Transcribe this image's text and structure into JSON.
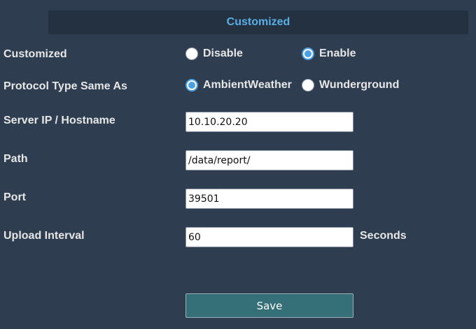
{
  "section": {
    "title": "Customized"
  },
  "fields": {
    "customized": {
      "label": "Customized",
      "options": [
        "Disable",
        "Enable"
      ],
      "selected": "Enable"
    },
    "protocol": {
      "label": "Protocol Type Same As",
      "options": [
        "AmbientWeather",
        "Wunderground"
      ],
      "selected": "AmbientWeather"
    },
    "server": {
      "label": "Server IP / Hostname",
      "value": "10.10.20.20"
    },
    "path": {
      "label": "Path",
      "value": "/data/report/"
    },
    "port": {
      "label": "Port",
      "value": "39501"
    },
    "upload_interval": {
      "label": "Upload Interval",
      "value": "60",
      "unit": "Seconds"
    }
  },
  "actions": {
    "save_label": "Save"
  },
  "colors": {
    "background": "#2e3e50",
    "header_background": "#243140",
    "header_text": "#5aaee8",
    "radio_accent": "#4a9fe6",
    "button": "#356f78"
  }
}
